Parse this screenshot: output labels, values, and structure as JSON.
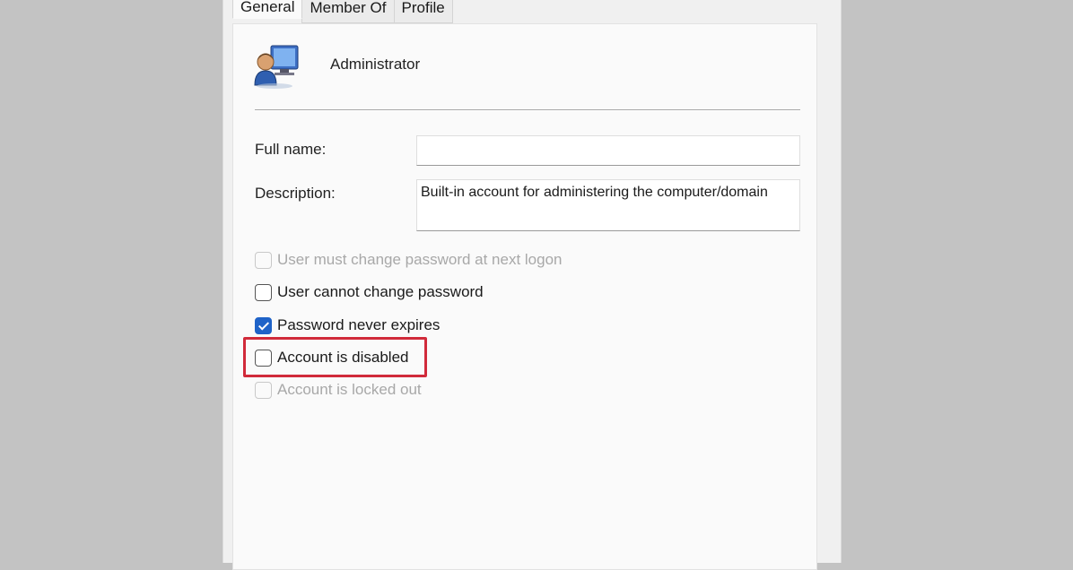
{
  "tabs": [
    {
      "label": "General",
      "active": true
    },
    {
      "label": "Member Of",
      "active": false
    },
    {
      "label": "Profile",
      "active": false
    }
  ],
  "header": {
    "icon": "user-account-icon",
    "name": "Administrator"
  },
  "form": {
    "full_name_label": "Full name:",
    "full_name_value": "",
    "description_label": "Description:",
    "description_value": "Built-in account for administering the computer/domain"
  },
  "checkboxes": [
    {
      "label": "User must change password at next logon",
      "checked": false,
      "enabled": false
    },
    {
      "label": "User cannot change password",
      "checked": false,
      "enabled": true
    },
    {
      "label": "Password never expires",
      "checked": true,
      "enabled": true
    },
    {
      "label": "Account is disabled",
      "checked": false,
      "enabled": true
    },
    {
      "label": "Account is locked out",
      "checked": false,
      "enabled": false
    }
  ],
  "colors": {
    "highlight": "#d12a3a",
    "checkbox_checked": "#1f63c8",
    "backdrop": "#c3c3c3"
  }
}
